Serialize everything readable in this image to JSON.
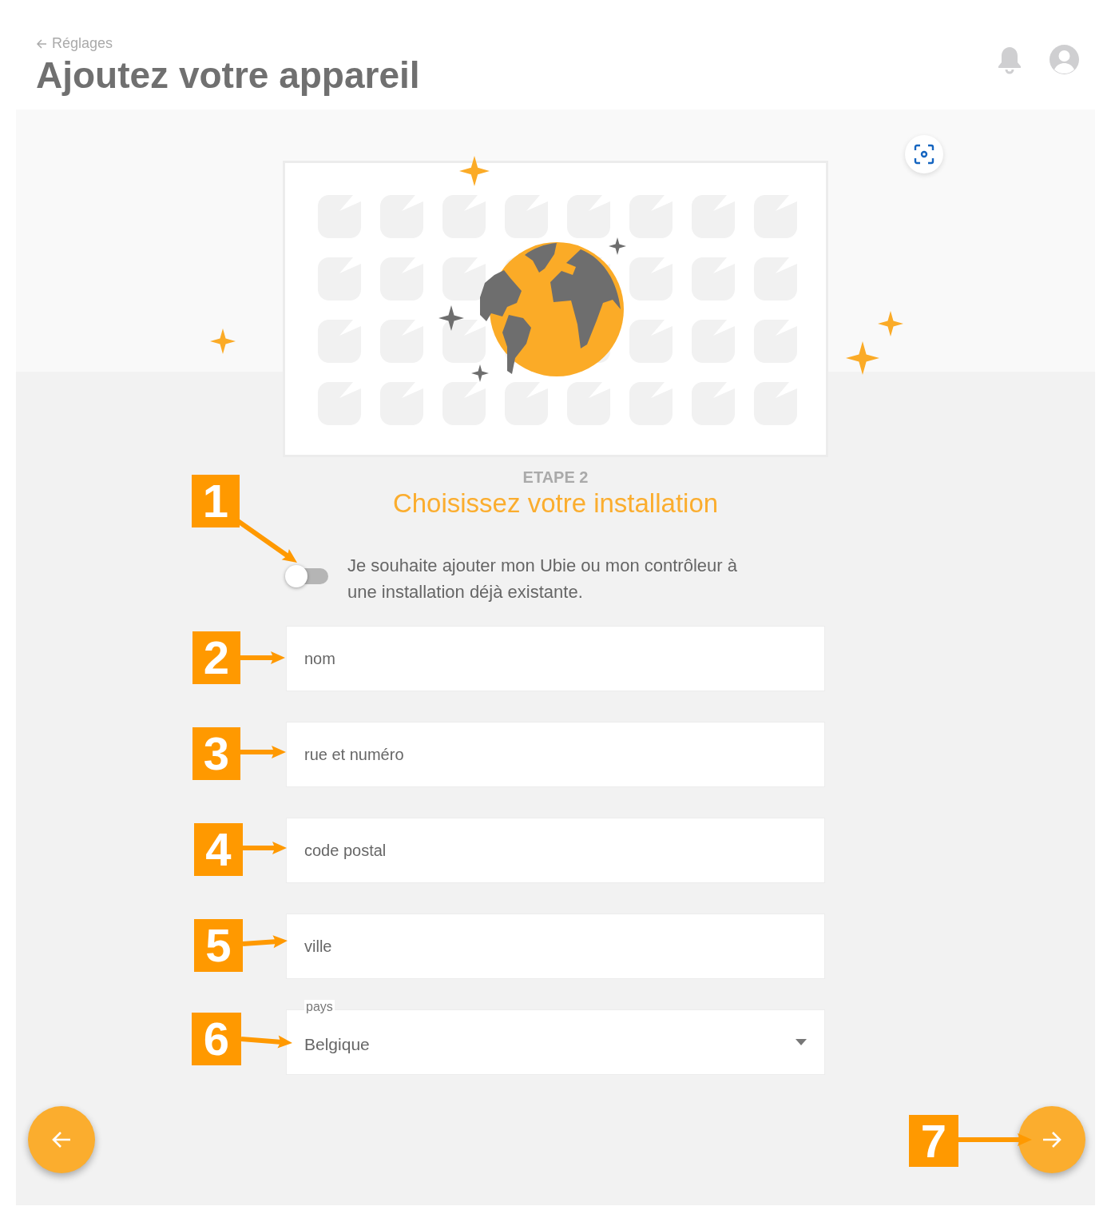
{
  "header": {
    "back_link": "Réglages",
    "title": "Ajoutez votre appareil"
  },
  "step": {
    "label": "ETAPE 2",
    "title": "Choisissez votre installation"
  },
  "toggle": {
    "on": false,
    "label": "Je souhaite ajouter mon Ubie ou mon contrôleur à une installation déjà existante."
  },
  "fields": [
    {
      "kind": "text",
      "placeholder": "nom"
    },
    {
      "kind": "text",
      "placeholder": "rue et numéro"
    },
    {
      "kind": "text",
      "placeholder": "code postal"
    },
    {
      "kind": "text",
      "placeholder": "ville"
    },
    {
      "kind": "select",
      "label": "pays",
      "value": "Belgique"
    }
  ],
  "annotations": [
    "1",
    "2",
    "3",
    "4",
    "5",
    "6",
    "7"
  ]
}
